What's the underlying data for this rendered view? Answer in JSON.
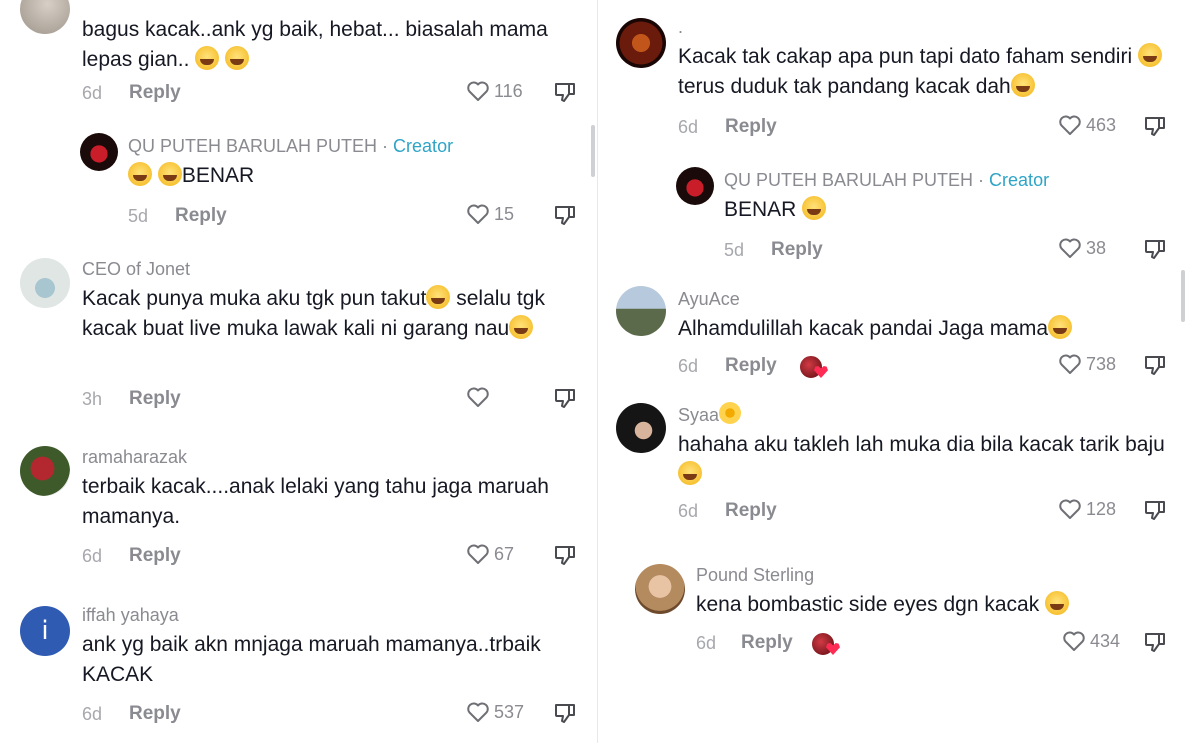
{
  "left": [
    {
      "name": "",
      "text": "bagus kacak..ank yg baik, hebat... biasalah mama lepas gian..",
      "emojis": 2,
      "time": "6d",
      "reply": "Reply",
      "likes": "116"
    },
    {
      "name": "QU PUTEH BARULAH PUTEH",
      "creator": "Creator",
      "text": "BENAR",
      "time": "5d",
      "reply": "Reply",
      "likes": "15"
    },
    {
      "name": "CEO of Jonet",
      "text1": "Kacak punya muka aku tgk pun takut",
      "text2": " selalu tgk kacak buat live muka lawak kali ni garang nau",
      "time": "3h",
      "reply": "Reply",
      "likes": ""
    },
    {
      "name": "ramaharazak",
      "text": "terbaik kacak....anak lelaki yang tahu jaga maruah mamanya.",
      "time": "6d",
      "reply": "Reply",
      "likes": "67"
    },
    {
      "name": "iffah yahaya",
      "avatar_letter": "i",
      "text": "ank yg baik akn mnjaga maruah mamanya..trbaik KACAK",
      "time": "6d",
      "reply": "Reply",
      "likes": "537"
    }
  ],
  "right": [
    {
      "name": ".",
      "text1": "Kacak tak cakap apa pun tapi dato faham sendiri",
      "text2": "terus duduk tak pandang kacak dah",
      "time": "6d",
      "reply": "Reply",
      "likes": "463"
    },
    {
      "name": "QU PUTEH BARULAH PUTEH",
      "creator": "Creator",
      "text": "BENAR",
      "time": "5d",
      "reply": "Reply",
      "likes": "38"
    },
    {
      "name": "AyuAce",
      "text": "Alhamdulillah kacak pandai Jaga mama",
      "time": "6d",
      "reply": "Reply",
      "likes": "738"
    },
    {
      "name": "Syaa",
      "text": "hahaha aku takleh lah muka dia bila kacak tarik baju",
      "time": "6d",
      "reply": "Reply",
      "likes": "128"
    },
    {
      "name": "Pound Sterling",
      "text": "kena bombastic side eyes dgn kacak",
      "time": "6d",
      "reply": "Reply",
      "likes": "434"
    }
  ],
  "separator": " · ",
  "colors": {
    "text": "#161823",
    "muted": "#8a8b91",
    "creator": "#2ea4c7",
    "like_heart": "#fe2c55"
  }
}
